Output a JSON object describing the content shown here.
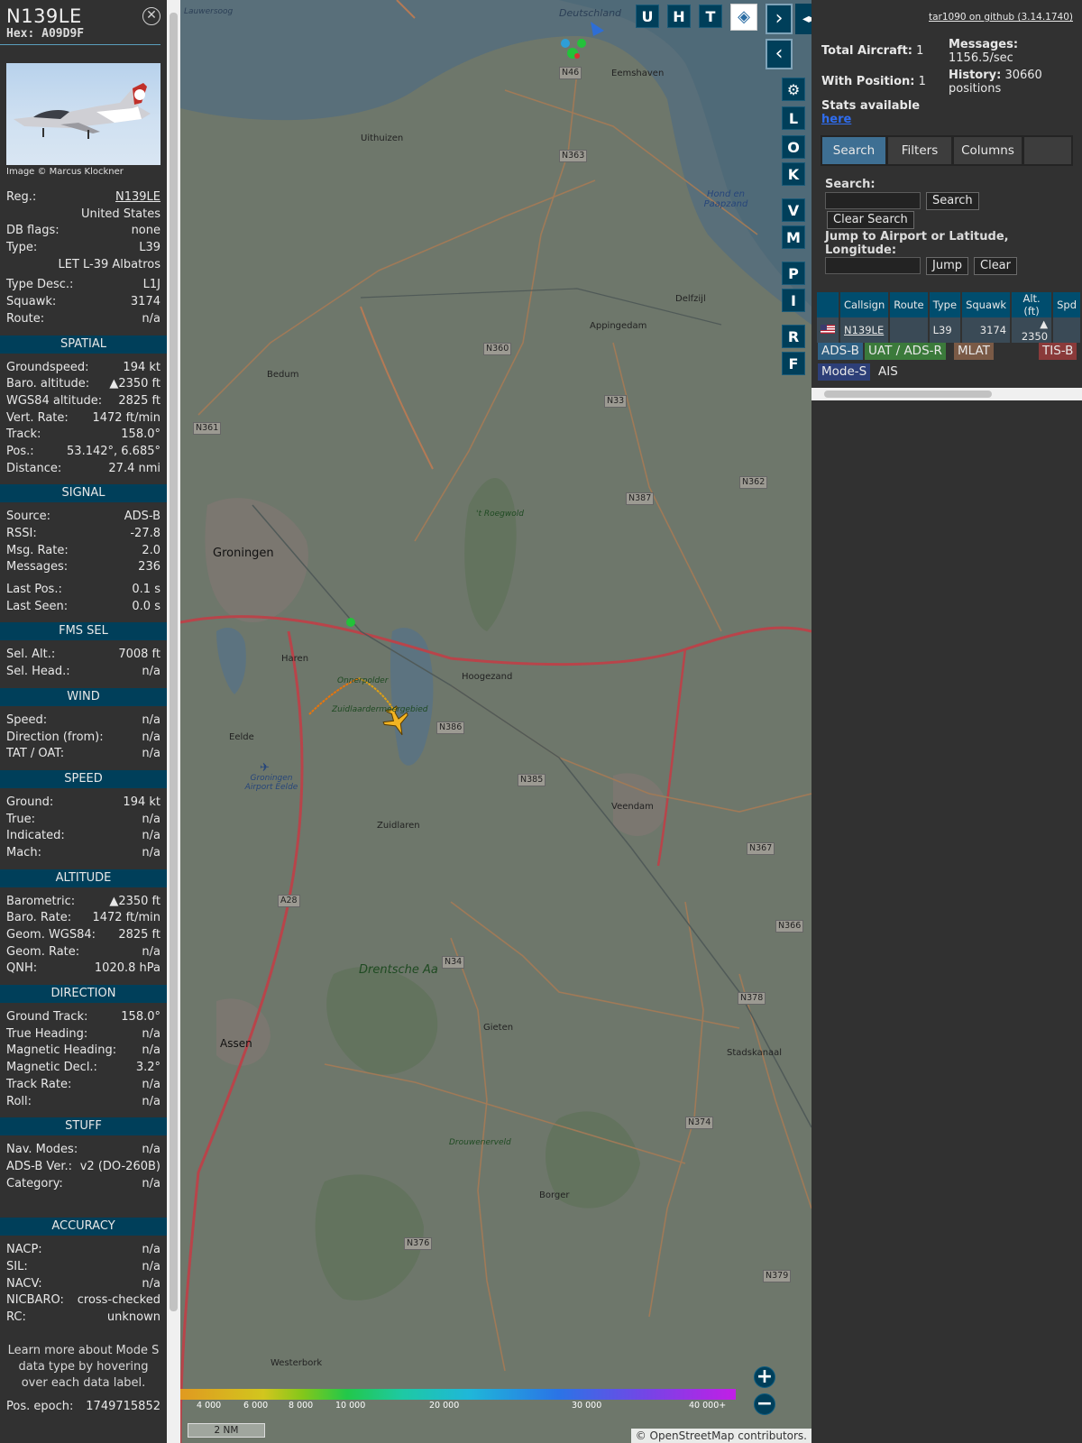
{
  "selected": {
    "callsign": "N139LE",
    "hex_label": "Hex:",
    "hex": "A09D9F",
    "photo_credit": "Image © Marcus Klockner",
    "info": {
      "reg_label": "Reg.:",
      "reg": "N139LE",
      "country": "United States",
      "dbflags_label": "DB flags:",
      "dbflags": "none",
      "type_label": "Type:",
      "type": "L39",
      "type_full": "LET L-39 Albatros",
      "typedesc_label": "Type Desc.:",
      "typedesc": "L1J",
      "squawk_label": "Squawk:",
      "squawk": "3174",
      "route_label": "Route:",
      "route": "n/a"
    },
    "spatial": {
      "title": "SPATIAL",
      "rows": [
        {
          "k": "Groundspeed:",
          "v": "194 kt"
        },
        {
          "k": "Baro. altitude:",
          "v": "▲2350 ft"
        },
        {
          "k": "WGS84 altitude:",
          "v": "2825 ft"
        },
        {
          "k": "Vert. Rate:",
          "v": "1472 ft/min"
        },
        {
          "k": "Track:",
          "v": "158.0°"
        },
        {
          "k": "Pos.:",
          "v": "53.142°, 6.685°"
        },
        {
          "k": "Distance:",
          "v": "27.4 nmi"
        }
      ]
    },
    "signal": {
      "title": "SIGNAL",
      "rows": [
        {
          "k": "Source:",
          "v": "ADS-B"
        },
        {
          "k": "RSSI:",
          "v": "-27.8"
        },
        {
          "k": "Msg. Rate:",
          "v": "2.0"
        },
        {
          "k": "Messages:",
          "v": "236"
        }
      ],
      "rows2": [
        {
          "k": "Last Pos.:",
          "v": "0.1 s"
        },
        {
          "k": "Last Seen:",
          "v": "0.0 s"
        }
      ]
    },
    "fms": {
      "title": "FMS SEL",
      "rows": [
        {
          "k": "Sel. Alt.:",
          "v": "7008 ft"
        },
        {
          "k": "Sel. Head.:",
          "v": "n/a"
        }
      ]
    },
    "wind": {
      "title": "WIND",
      "rows": [
        {
          "k": "Speed:",
          "v": "n/a"
        },
        {
          "k": "Direction (from):",
          "v": "n/a"
        },
        {
          "k": "TAT / OAT:",
          "v": "n/a"
        }
      ]
    },
    "speed": {
      "title": "SPEED",
      "rows": [
        {
          "k": "Ground:",
          "v": "194 kt"
        },
        {
          "k": "True:",
          "v": "n/a"
        },
        {
          "k": "Indicated:",
          "v": "n/a"
        },
        {
          "k": "Mach:",
          "v": "n/a"
        }
      ]
    },
    "altitude": {
      "title": "ALTITUDE",
      "rows": [
        {
          "k": "Barometric:",
          "v": "▲2350 ft"
        },
        {
          "k": "Baro. Rate:",
          "v": "1472 ft/min"
        },
        {
          "k": "Geom. WGS84:",
          "v": "2825 ft"
        },
        {
          "k": "Geom. Rate:",
          "v": "n/a"
        },
        {
          "k": "QNH:",
          "v": "1020.8 hPa"
        }
      ]
    },
    "direction": {
      "title": "DIRECTION",
      "rows": [
        {
          "k": "Ground Track:",
          "v": "158.0°"
        },
        {
          "k": "True Heading:",
          "v": "n/a"
        },
        {
          "k": "Magnetic Heading:",
          "v": "n/a"
        },
        {
          "k": "Magnetic Decl.:",
          "v": "3.2°"
        },
        {
          "k": "Track Rate:",
          "v": "n/a"
        },
        {
          "k": "Roll:",
          "v": "n/a"
        }
      ]
    },
    "stuff": {
      "title": "STUFF",
      "rows": [
        {
          "k": "Nav. Modes:",
          "v": "n/a"
        },
        {
          "k": "ADS-B Ver.:",
          "v": "v2 (DO-260B)"
        },
        {
          "k": "Category:",
          "v": "n/a"
        }
      ]
    },
    "accuracy": {
      "title": "ACCURACY",
      "rows": [
        {
          "k": "NACP:",
          "v": "n/a"
        },
        {
          "k": "SIL:",
          "v": "n/a"
        },
        {
          "k": "NACV:",
          "v": "n/a"
        },
        {
          "k": "NICBARO:",
          "v": "cross-checked"
        },
        {
          "k": "RC:",
          "v": "unknown"
        }
      ]
    },
    "note": "Learn more about Mode S data type by hovering over each data label.",
    "epoch_label": "Pos. epoch:",
    "epoch": "1749715852"
  },
  "map": {
    "toggle_buttons": [
      "U",
      "H",
      "T"
    ],
    "side_buttons": [
      "L",
      "O",
      "K",
      "V",
      "M",
      "P",
      "I",
      "R",
      "F"
    ],
    "places": [
      {
        "t": "Deutschland"
      },
      {
        "t": "Lauwersoog"
      },
      {
        "t": "Eemshaven"
      },
      {
        "t": "Uithuizen"
      },
      {
        "t": "Delfzijl"
      },
      {
        "t": "Appingedam"
      },
      {
        "t": "Bedum"
      },
      {
        "t": "Groningen"
      },
      {
        "t": "Haren"
      },
      {
        "t": "Hoogezand"
      },
      {
        "t": "Eelde"
      },
      {
        "t": "Zuidlaren"
      },
      {
        "t": "Veendam"
      },
      {
        "t": "Gieten"
      },
      {
        "t": "Assen"
      },
      {
        "t": "Stadskanaal"
      },
      {
        "t": "Borger"
      },
      {
        "t": "Westerbork"
      },
      {
        "t": "Drentsche Aa"
      },
      {
        "t": "Onnerpolder"
      },
      {
        "t": "Zuidlaardermeergebied"
      },
      {
        "t": "Groningen Airport Eelde"
      },
      {
        "t": "'t Roegwold"
      },
      {
        "t": "Drouwenerveld"
      },
      {
        "t": "Hond en Paapzand"
      }
    ],
    "road_labels": [
      "N46",
      "N363",
      "N360",
      "N33",
      "N361",
      "N362",
      "N387",
      "N386",
      "N385",
      "N367",
      "N34",
      "N366",
      "N378",
      "N374",
      "N379",
      "N376",
      "A28"
    ],
    "scale_label": "2 NM",
    "altitude_legend": [
      "4 000",
      "6 000",
      "8 000",
      "10 000",
      "20 000",
      "30 000",
      "40 000+"
    ],
    "attribution": "© OpenStreetMap contributors."
  },
  "right": {
    "credit": "tar1090 on github (3.14.1740)",
    "total_aircraft_label": "Total Aircraft:",
    "total_aircraft": "1",
    "with_position_label": "With Position:",
    "with_position": "1",
    "messages_label": "Messages:",
    "messages": "1156.5/sec",
    "history_label": "History:",
    "history": "30660 positions",
    "stats_label": "Stats available",
    "stats_link": "here",
    "tabs": [
      "Search",
      "Filters",
      "Columns"
    ],
    "search_label": "Search:",
    "search_button": "Search",
    "clear_search_button": "Clear Search",
    "jump_label": "Jump to Airport or Latitude, Longitude:",
    "jump_button": "Jump",
    "clear_button": "Clear",
    "table": {
      "columns": [
        "Callsign",
        "Route",
        "Type",
        "Squawk",
        "Alt. (ft)",
        "Spd"
      ],
      "rows": [
        {
          "callsign": "N139LE",
          "route": "",
          "type": "L39",
          "squawk": "3174",
          "alt": "▲ 2350",
          "spd": ""
        }
      ]
    },
    "source_badges": [
      {
        "label": "ADS-B",
        "color": "#2e5f82"
      },
      {
        "label": "UAT / ADS-R",
        "color": "#3b7a3b"
      },
      {
        "label": "MLAT",
        "color": "#7a5a46"
      },
      {
        "label": "TIS-B",
        "color": "#8a3a3a"
      },
      {
        "label": "Mode-S",
        "color": "#2d3f78"
      },
      {
        "label": "AIS",
        "color": ""
      }
    ]
  }
}
